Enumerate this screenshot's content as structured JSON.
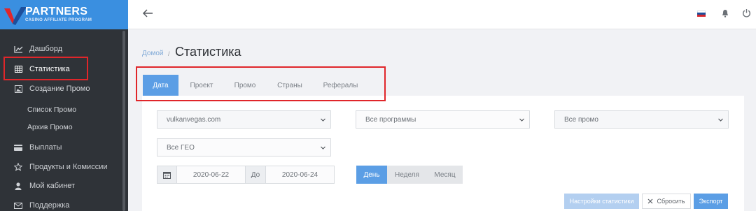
{
  "brand": {
    "name": "PARTNERS",
    "tagline": "CASINO AFFILIATE PROGRAM",
    "colors": {
      "blue": "#3a8fe0",
      "red": "#e0262a"
    }
  },
  "sidebar": {
    "items": [
      {
        "label": "Дашборд",
        "icon": "chart-line-icon"
      },
      {
        "label": "Статистика",
        "icon": "grid-table-icon",
        "active": true
      },
      {
        "label": "Создание Промо",
        "icon": "image-icon"
      },
      {
        "label": "Список Промо"
      },
      {
        "label": "Архив Промо"
      },
      {
        "label": "Выплаты",
        "icon": "credit-card-icon"
      },
      {
        "label": "Продукты и Комиссии",
        "icon": "star-icon"
      },
      {
        "label": "Мой кабинет",
        "icon": "user-icon"
      },
      {
        "label": "Поддержка",
        "icon": "mail-icon"
      }
    ]
  },
  "topbar": {
    "icons": [
      "arrow-left-icon",
      "russian-flag-icon",
      "bell-icon",
      "power-icon"
    ]
  },
  "breadcrumb": {
    "home": "Домой",
    "separator": "/"
  },
  "page": {
    "title": "Статистика"
  },
  "tabs": [
    {
      "label": "Дата",
      "active": true
    },
    {
      "label": "Проект"
    },
    {
      "label": "Промо"
    },
    {
      "label": "Страны"
    },
    {
      "label": "Рефералы"
    }
  ],
  "filters": {
    "project": "vulkanvegas.com",
    "programs": "Все программы",
    "promo": "Все промо",
    "geo": "Все ГЕО"
  },
  "dates": {
    "from": "2020-06-22",
    "to_label": "До",
    "to": "2020-06-24"
  },
  "period": [
    {
      "label": "День",
      "active": true
    },
    {
      "label": "Неделя"
    },
    {
      "label": "Месяц"
    }
  ],
  "actions": {
    "settings": "Настройки статистики",
    "reset": "Сбросить",
    "export": "Экспорт"
  },
  "accent_color": "#5b9ee5"
}
